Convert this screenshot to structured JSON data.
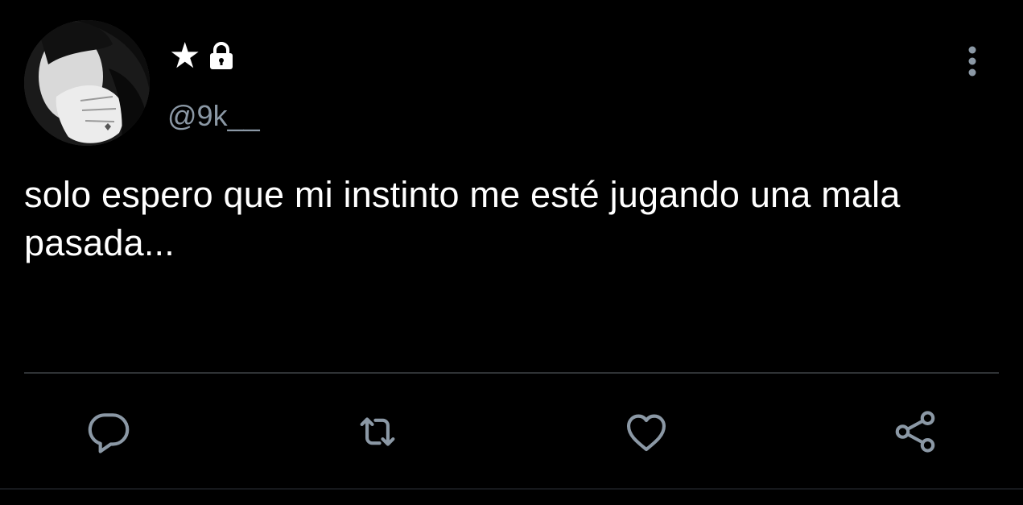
{
  "tweet": {
    "display_name": "★",
    "handle": "@9k__",
    "text": "solo espero que mi instinto me esté jugando una mala pasada..."
  },
  "icons": {
    "lock": "lock-icon",
    "more": "more-vertical-icon",
    "reply": "reply-icon",
    "retweet": "retweet-icon",
    "like": "heart-icon",
    "share": "share-icon"
  },
  "colors": {
    "background": "#000000",
    "text": "#ffffff",
    "secondary": "#8b98a5",
    "divider": "#2f3336"
  }
}
